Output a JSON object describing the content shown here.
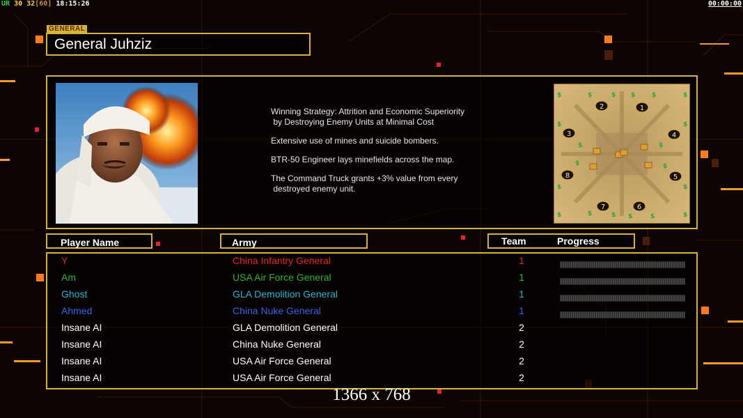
{
  "hud": {
    "ur_label": "UR",
    "val1": "30",
    "val2": "32",
    "val3": "[60]",
    "clock": "18:15:26",
    "timer": "00:00:00"
  },
  "header": {
    "tag": "GENERAL",
    "title": "General Juhziz"
  },
  "strategy": {
    "lines": [
      "Winning Strategy: Attrition and Economic Superiority\n by Destroying Enemy Units at Minimal Cost",
      "Extensive use of mines and suicide bombers.",
      "BTR-50 Engineer lays minefields across the map.",
      "The Command Truck grants +3% value from every\n destroyed enemy unit."
    ]
  },
  "minimap": {
    "start_positions": [
      "1",
      "2",
      "3",
      "4",
      "5",
      "6",
      "7",
      "8"
    ]
  },
  "columns": {
    "player": "Player Name",
    "army": "Army",
    "team": "Team",
    "progress": "Progress"
  },
  "players": [
    {
      "name": "Y",
      "army": "China Infantry General",
      "team": "1",
      "color": "#e8232a",
      "has_progress": true,
      "progress": 0
    },
    {
      "name": "Am",
      "army": "USA Air Force General",
      "team": "1",
      "color": "#2fb53a",
      "has_progress": true,
      "progress": 0
    },
    {
      "name": "Ghost",
      "army": "GLA Demolition General",
      "team": "1",
      "color": "#29b6d6",
      "has_progress": true,
      "progress": 0
    },
    {
      "name": "Ahmed",
      "army": "China Nuke General",
      "team": "1",
      "color": "#3a64e8",
      "has_progress": true,
      "progress": 0
    },
    {
      "name": "Insane AI",
      "army": "GLA Demolition General",
      "team": "2",
      "color": "#ffffff",
      "has_progress": false
    },
    {
      "name": "Insane AI",
      "army": "China Nuke General",
      "team": "2",
      "color": "#ffffff",
      "has_progress": false
    },
    {
      "name": "Insane AI",
      "army": "USA Air Force General",
      "team": "2",
      "color": "#ffffff",
      "has_progress": false
    },
    {
      "name": "Insane AI",
      "army": "USA Air Force General",
      "team": "2",
      "color": "#ffffff",
      "has_progress": false
    }
  ],
  "resolution_label": "1366 x 768"
}
